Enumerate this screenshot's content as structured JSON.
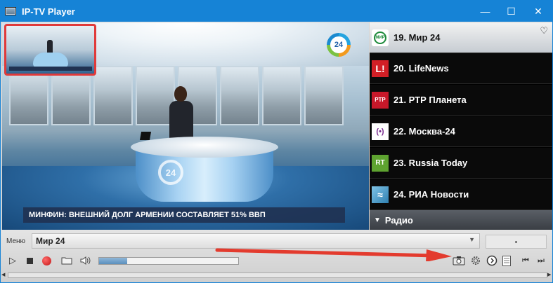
{
  "window": {
    "title": "IP-TV Player",
    "controls": {
      "minimize": "—",
      "maximize": "☐",
      "close": "✕"
    }
  },
  "video": {
    "channel_logo": "24",
    "desk_logo": "24",
    "ticker": "МИНФИН: ВНЕШНИЙ ДОЛГ АРМЕНИИ СОСТАВЛЯЕТ 51% ВВП"
  },
  "channels": {
    "items": [
      {
        "name": "19. Мир 24",
        "icon": "mir24-logo",
        "icon_text": "МИР",
        "active": true,
        "favorite": true,
        "icon_bg": "#ffffff",
        "icon_color": "#1d8a3a"
      },
      {
        "name": "20. LifeNews",
        "icon": "lifenews-logo",
        "icon_text": "L!",
        "active": false,
        "icon_bg": "#d21f26",
        "icon_color": "#ffffff"
      },
      {
        "name": "21. РТР Планета",
        "icon": "rtr-logo",
        "icon_text": "РТР",
        "active": false,
        "icon_bg": "#c8182a",
        "icon_color": "#ffffff"
      },
      {
        "name": "22. Москва-24",
        "icon": "moskva24-logo",
        "icon_text": "(•)",
        "active": false,
        "icon_bg": "#ffffff",
        "icon_color": "#7a2b8f"
      },
      {
        "name": "23. Russia Today",
        "icon": "rt-logo",
        "icon_text": "RT",
        "active": false,
        "icon_bg": "#5ea330",
        "icon_color": "#ffffff"
      },
      {
        "name": "24. РИА Новости",
        "icon": "ria-logo",
        "icon_text": "≈",
        "active": false,
        "icon_bg": "#3a8bb8",
        "icon_color": "#ffffff"
      }
    ],
    "group_header": "Радио"
  },
  "controls": {
    "menu_label": "Меню",
    "selected_channel": "Мир 24",
    "volume_level": 0.2,
    "buttons": {
      "play": "▷",
      "stop": "stop-icon",
      "record": "record-icon",
      "folder": "folder-icon",
      "volume": "speaker-icon",
      "screenshot": "camera-icon",
      "settings": "gear-icon",
      "schedule": "clock-icon",
      "playlist": "list-icon",
      "prev": "⏮",
      "next": "⏭"
    }
  },
  "colors": {
    "titlebar": "#1683d6",
    "annotation_arrow": "#e33b2e",
    "pip_border": "#e03a3a"
  }
}
